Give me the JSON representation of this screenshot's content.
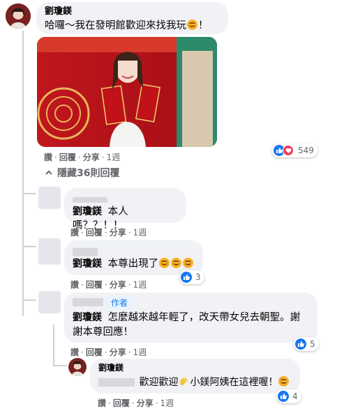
{
  "colors": {
    "bubble": "#f0f2f5",
    "link": "#1877f2",
    "meta": "#65676b",
    "like": "#1877f2",
    "love": "#f33e58",
    "poster_red": "#c8161d"
  },
  "top_comment": {
    "author": "劉瓊鎂",
    "text": "哈囉～我在發明館歡迎來找我玩",
    "text_end": "！",
    "actions": {
      "like": "讚",
      "reply": "回覆",
      "share": "分享",
      "time": "1週"
    },
    "reaction_count": "549"
  },
  "hide_replies": {
    "label": "隱藏36則回覆"
  },
  "replies": [
    {
      "mention": "劉瓊鎂",
      "text": "本人嗎？？！！",
      "actions": {
        "like": "讚",
        "reply": "回覆",
        "share": "分享",
        "time": "1週"
      }
    },
    {
      "mention": "劉瓊鎂",
      "text": "本尊出現了",
      "actions": {
        "like": "讚",
        "reply": "回覆",
        "share": "分享",
        "time": "1週"
      },
      "reaction_count": "3"
    },
    {
      "badge": "作者",
      "mention": "劉瓊鎂",
      "text_line1": "怎麼越來越年輕了，改天帶女兒去朝聖。謝",
      "text_line2": "謝本尊回應！",
      "actions": {
        "like": "讚",
        "reply": "回覆",
        "share": "分享",
        "time": "1週"
      },
      "reaction_count": "5"
    }
  ],
  "nested_reply": {
    "author": "劉瓊鎂",
    "text_a": "歡迎歡迎",
    "text_b": "小鎂阿姨在這裡喔！",
    "actions": {
      "like": "讚",
      "reply": "回覆",
      "share": "分享",
      "time": "1週"
    },
    "reaction_count": "4"
  }
}
